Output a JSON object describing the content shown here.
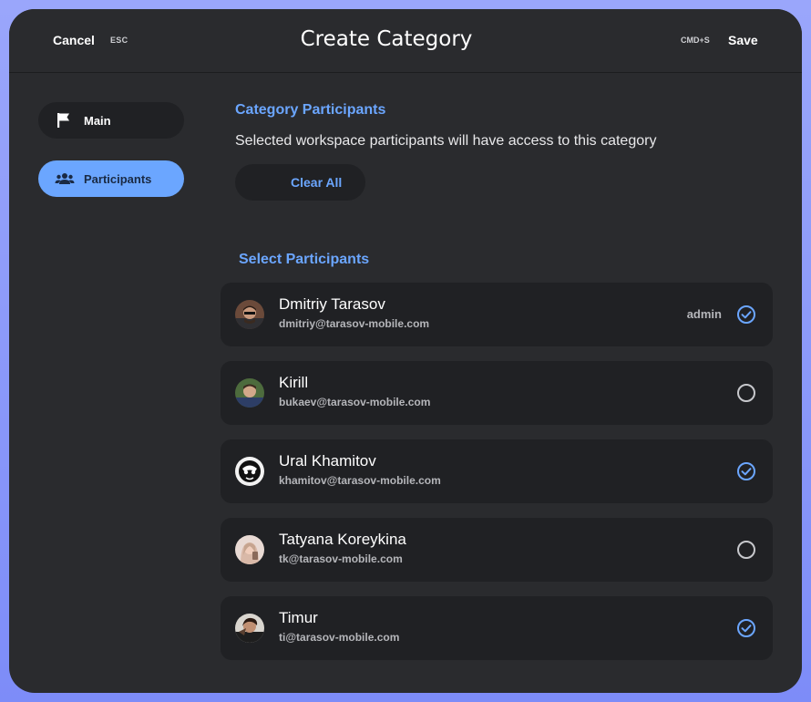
{
  "header": {
    "cancel_label": "Cancel",
    "cancel_shortcut": "ESC",
    "title": "Create Category",
    "save_shortcut": "CMD+S",
    "save_label": "Save"
  },
  "sidebar": {
    "items": [
      {
        "label": "Main",
        "icon": "flag-icon",
        "active": false
      },
      {
        "label": "Participants",
        "icon": "people-icon",
        "active": true
      }
    ]
  },
  "main": {
    "section_title": "Category Participants",
    "description": "Selected workspace participants will have access to this category",
    "clear_all_label": "Clear All",
    "select_title": "Select Participants",
    "participants": [
      {
        "name": "Dmitriy Tarasov",
        "email": "dmitriy@tarasov-mobile.com",
        "role": "admin",
        "selected": true
      },
      {
        "name": "Kirill",
        "email": "bukaev@tarasov-mobile.com",
        "role": "",
        "selected": false
      },
      {
        "name": "Ural Khamitov",
        "email": "khamitov@tarasov-mobile.com",
        "role": "",
        "selected": true
      },
      {
        "name": "Tatyana Koreykina",
        "email": "tk@tarasov-mobile.com",
        "role": "",
        "selected": false
      },
      {
        "name": "Timur",
        "email": "ti@tarasov-mobile.com",
        "role": "",
        "selected": true
      }
    ]
  },
  "colors": {
    "accent": "#6ba6ff",
    "window_bg": "#2a2b2e",
    "row_bg": "#202124",
    "frame": "#8f9cfa"
  }
}
